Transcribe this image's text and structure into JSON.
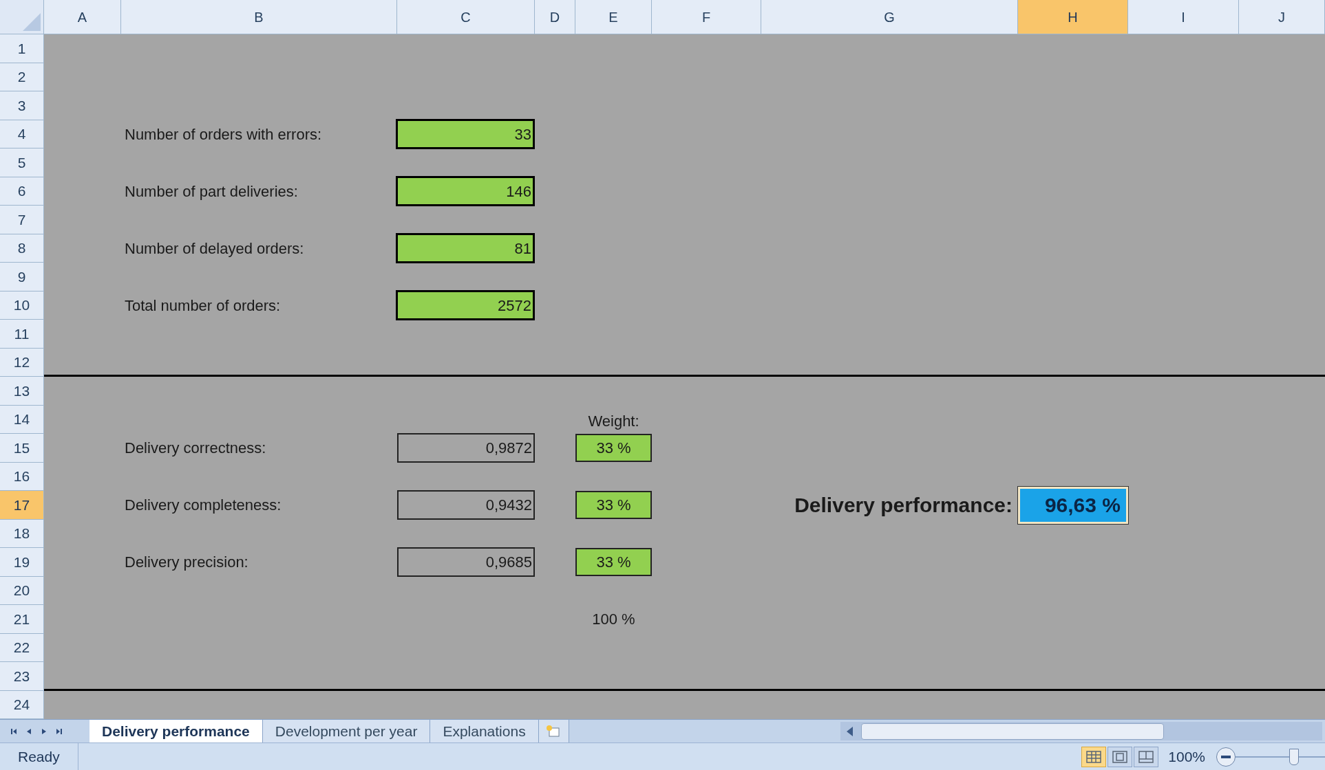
{
  "column_headers": [
    {
      "label": "A",
      "selected": false
    },
    {
      "label": "B",
      "selected": false
    },
    {
      "label": "C",
      "selected": false
    },
    {
      "label": "D",
      "selected": false
    },
    {
      "label": "E",
      "selected": false
    },
    {
      "label": "F",
      "selected": false
    },
    {
      "label": "G",
      "selected": false
    },
    {
      "label": "H",
      "selected": true
    },
    {
      "label": "I",
      "selected": false
    },
    {
      "label": "J",
      "selected": false
    }
  ],
  "row_headers": [
    {
      "label": "1",
      "selected": false
    },
    {
      "label": "2",
      "selected": false
    },
    {
      "label": "3",
      "selected": false
    },
    {
      "label": "4",
      "selected": false
    },
    {
      "label": "5",
      "selected": false
    },
    {
      "label": "6",
      "selected": false
    },
    {
      "label": "7",
      "selected": false
    },
    {
      "label": "8",
      "selected": false
    },
    {
      "label": "9",
      "selected": false
    },
    {
      "label": "10",
      "selected": false
    },
    {
      "label": "11",
      "selected": false
    },
    {
      "label": "12",
      "selected": false
    },
    {
      "label": "13",
      "selected": false
    },
    {
      "label": "14",
      "selected": false
    },
    {
      "label": "15",
      "selected": false
    },
    {
      "label": "16",
      "selected": false
    },
    {
      "label": "17",
      "selected": true
    },
    {
      "label": "18",
      "selected": false
    },
    {
      "label": "19",
      "selected": false
    },
    {
      "label": "20",
      "selected": false
    },
    {
      "label": "21",
      "selected": false
    },
    {
      "label": "22",
      "selected": false
    },
    {
      "label": "23",
      "selected": false
    },
    {
      "label": "24",
      "selected": false
    }
  ],
  "inputs": [
    {
      "label": "Number of orders with errors:",
      "value": "33"
    },
    {
      "label": "Number of part deliveries:",
      "value": "146"
    },
    {
      "label": "Number of delayed orders:",
      "value": "81"
    },
    {
      "label": "Total number of orders:",
      "value": "2572"
    }
  ],
  "weight_heading": "Weight:",
  "metrics": [
    {
      "label": "Delivery correctness:",
      "value": "0,9872",
      "weight": "33 %"
    },
    {
      "label": "Delivery completeness:",
      "value": "0,9432",
      "weight": "33 %"
    },
    {
      "label": "Delivery precision:",
      "value": "0,9685",
      "weight": "33 %"
    }
  ],
  "weight_total": "100 %",
  "result": {
    "label": "Delivery performance:",
    "value": "96,63 %",
    "selected": true
  },
  "sheet_tabs": [
    {
      "label": "Delivery performance",
      "selected": true
    },
    {
      "label": "Development per year",
      "selected": false
    },
    {
      "label": "Explanations",
      "selected": false
    }
  ],
  "status_bar": {
    "status": "Ready",
    "zoom": "100%",
    "zoom_slider": {
      "level": 0.65
    },
    "view_buttons": [
      {
        "selected": true
      },
      {
        "selected": false
      },
      {
        "selected": false
      }
    ]
  }
}
